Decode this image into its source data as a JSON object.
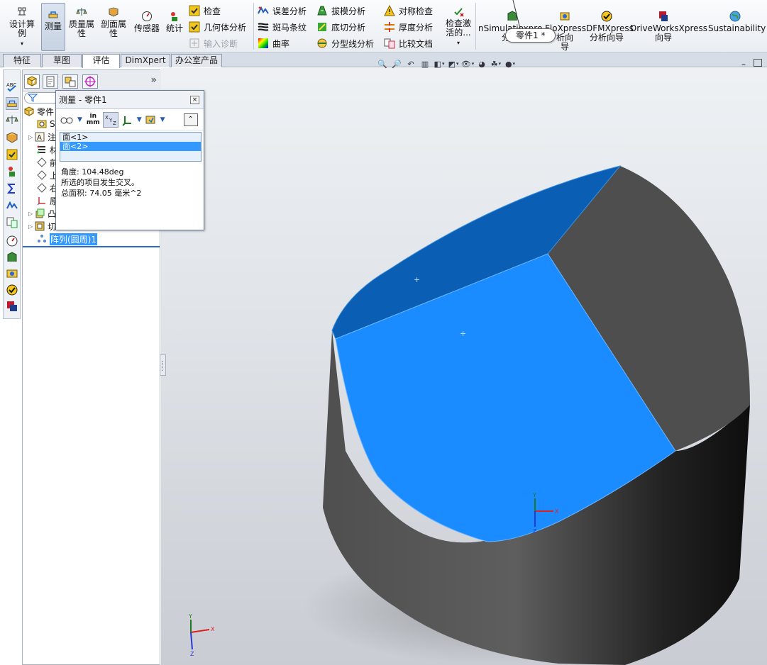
{
  "ribbon": {
    "design_study": "设计算例",
    "measure": "测量",
    "mass_props_l1": "质量属",
    "mass_props_l2": "性",
    "section_props_l1": "剖面属",
    "section_props_l2": "性",
    "sensor": "传感器",
    "statistics": "统计",
    "check": "检查",
    "geometry_analysis": "几何体分析",
    "import_diagnostics": "输入诊断",
    "deviation_analysis": "误差分析",
    "zebra_stripes": "斑马条纹",
    "curvature": "曲率",
    "draft_analysis": "拔模分析",
    "undercut_analysis": "底切分析",
    "parting_line_analysis": "分型线分析",
    "symmetry_check": "对称检查",
    "thickness_analysis": "厚度分析",
    "compare_documents": "比较文档",
    "check_active_l1": "检查激",
    "check_active_l2": "活的...",
    "simulation_l1": "nSimulatio",
    "simulation_l1b": "xpress",
    "simulation_l2": "分析",
    "floxpress_l1": "FloXpress",
    "floxpress_l2": "析向",
    "floxpress_l3": "导",
    "dfmxpress_l1": "DFMXpress",
    "dfmxpress_l2": "分析向导",
    "driveworks_l1": "DriveWorksXpress",
    "driveworks_l2": "向导",
    "sustainability": "Sustainability"
  },
  "tooltip": "零件1 *",
  "tabs": [
    "特征",
    "草图",
    "评估",
    "DimXpert",
    "办公室产品"
  ],
  "active_tab": "评估",
  "tree": {
    "root": "零件",
    "items": [
      "S",
      "注",
      "材",
      "前",
      "上",
      "右",
      "原",
      "凸",
      "切"
    ],
    "selected": "阵列(圆周)1"
  },
  "measure": {
    "title": "测量 - 零件1",
    "unit_in": "in",
    "unit_mm": "mm",
    "selections": [
      "面<1>",
      "面<2>"
    ],
    "selected_index": 1,
    "angle": "角度: 104.48deg",
    "note": "所选的项目发生交叉。",
    "area": "总面积: 74.05 毫米^2"
  },
  "triad": {
    "x": "X",
    "y": "Y",
    "z": "Z"
  },
  "colors": {
    "face1": "#0a5fb4",
    "face2": "#1a8cff",
    "body_dark": "#4e4e4e",
    "body_cyl": "#2a2a2a",
    "selection": "#3399ff"
  }
}
